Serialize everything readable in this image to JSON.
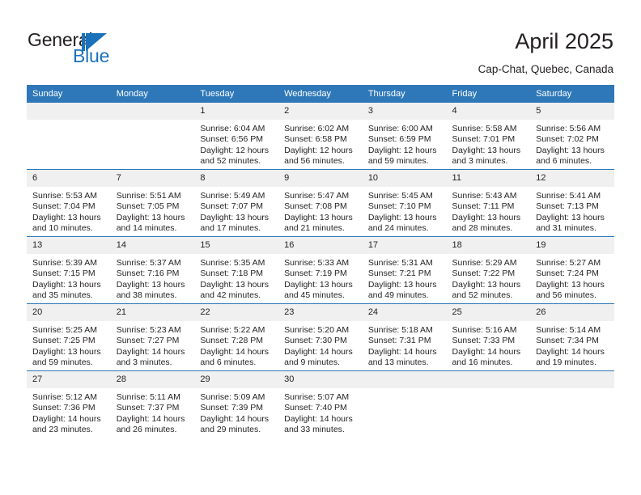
{
  "brand": {
    "name_part1": "General",
    "name_part2": "Blue",
    "logo_icon": "flag-triangle-icon",
    "accent_color": "#1b72bb"
  },
  "header": {
    "title": "April 2025",
    "subtitle": "Cap-Chat, Quebec, Canada"
  },
  "calendar": {
    "header_bg": "#2e77b8",
    "daynum_bg": "#f0f0f0",
    "weekday_headers": [
      "Sunday",
      "Monday",
      "Tuesday",
      "Wednesday",
      "Thursday",
      "Friday",
      "Saturday"
    ],
    "weeks": [
      [
        {
          "day": "",
          "sunrise": "",
          "sunset": "",
          "daylight_line1": "",
          "daylight_line2": ""
        },
        {
          "day": "",
          "sunrise": "",
          "sunset": "",
          "daylight_line1": "",
          "daylight_line2": ""
        },
        {
          "day": "1",
          "sunrise": "Sunrise: 6:04 AM",
          "sunset": "Sunset: 6:56 PM",
          "daylight_line1": "Daylight: 12 hours",
          "daylight_line2": "and 52 minutes."
        },
        {
          "day": "2",
          "sunrise": "Sunrise: 6:02 AM",
          "sunset": "Sunset: 6:58 PM",
          "daylight_line1": "Daylight: 12 hours",
          "daylight_line2": "and 56 minutes."
        },
        {
          "day": "3",
          "sunrise": "Sunrise: 6:00 AM",
          "sunset": "Sunset: 6:59 PM",
          "daylight_line1": "Daylight: 12 hours",
          "daylight_line2": "and 59 minutes."
        },
        {
          "day": "4",
          "sunrise": "Sunrise: 5:58 AM",
          "sunset": "Sunset: 7:01 PM",
          "daylight_line1": "Daylight: 13 hours",
          "daylight_line2": "and 3 minutes."
        },
        {
          "day": "5",
          "sunrise": "Sunrise: 5:56 AM",
          "sunset": "Sunset: 7:02 PM",
          "daylight_line1": "Daylight: 13 hours",
          "daylight_line2": "and 6 minutes."
        }
      ],
      [
        {
          "day": "6",
          "sunrise": "Sunrise: 5:53 AM",
          "sunset": "Sunset: 7:04 PM",
          "daylight_line1": "Daylight: 13 hours",
          "daylight_line2": "and 10 minutes."
        },
        {
          "day": "7",
          "sunrise": "Sunrise: 5:51 AM",
          "sunset": "Sunset: 7:05 PM",
          "daylight_line1": "Daylight: 13 hours",
          "daylight_line2": "and 14 minutes."
        },
        {
          "day": "8",
          "sunrise": "Sunrise: 5:49 AM",
          "sunset": "Sunset: 7:07 PM",
          "daylight_line1": "Daylight: 13 hours",
          "daylight_line2": "and 17 minutes."
        },
        {
          "day": "9",
          "sunrise": "Sunrise: 5:47 AM",
          "sunset": "Sunset: 7:08 PM",
          "daylight_line1": "Daylight: 13 hours",
          "daylight_line2": "and 21 minutes."
        },
        {
          "day": "10",
          "sunrise": "Sunrise: 5:45 AM",
          "sunset": "Sunset: 7:10 PM",
          "daylight_line1": "Daylight: 13 hours",
          "daylight_line2": "and 24 minutes."
        },
        {
          "day": "11",
          "sunrise": "Sunrise: 5:43 AM",
          "sunset": "Sunset: 7:11 PM",
          "daylight_line1": "Daylight: 13 hours",
          "daylight_line2": "and 28 minutes."
        },
        {
          "day": "12",
          "sunrise": "Sunrise: 5:41 AM",
          "sunset": "Sunset: 7:13 PM",
          "daylight_line1": "Daylight: 13 hours",
          "daylight_line2": "and 31 minutes."
        }
      ],
      [
        {
          "day": "13",
          "sunrise": "Sunrise: 5:39 AM",
          "sunset": "Sunset: 7:15 PM",
          "daylight_line1": "Daylight: 13 hours",
          "daylight_line2": "and 35 minutes."
        },
        {
          "day": "14",
          "sunrise": "Sunrise: 5:37 AM",
          "sunset": "Sunset: 7:16 PM",
          "daylight_line1": "Daylight: 13 hours",
          "daylight_line2": "and 38 minutes."
        },
        {
          "day": "15",
          "sunrise": "Sunrise: 5:35 AM",
          "sunset": "Sunset: 7:18 PM",
          "daylight_line1": "Daylight: 13 hours",
          "daylight_line2": "and 42 minutes."
        },
        {
          "day": "16",
          "sunrise": "Sunrise: 5:33 AM",
          "sunset": "Sunset: 7:19 PM",
          "daylight_line1": "Daylight: 13 hours",
          "daylight_line2": "and 45 minutes."
        },
        {
          "day": "17",
          "sunrise": "Sunrise: 5:31 AM",
          "sunset": "Sunset: 7:21 PM",
          "daylight_line1": "Daylight: 13 hours",
          "daylight_line2": "and 49 minutes."
        },
        {
          "day": "18",
          "sunrise": "Sunrise: 5:29 AM",
          "sunset": "Sunset: 7:22 PM",
          "daylight_line1": "Daylight: 13 hours",
          "daylight_line2": "and 52 minutes."
        },
        {
          "day": "19",
          "sunrise": "Sunrise: 5:27 AM",
          "sunset": "Sunset: 7:24 PM",
          "daylight_line1": "Daylight: 13 hours",
          "daylight_line2": "and 56 minutes."
        }
      ],
      [
        {
          "day": "20",
          "sunrise": "Sunrise: 5:25 AM",
          "sunset": "Sunset: 7:25 PM",
          "daylight_line1": "Daylight: 13 hours",
          "daylight_line2": "and 59 minutes."
        },
        {
          "day": "21",
          "sunrise": "Sunrise: 5:23 AM",
          "sunset": "Sunset: 7:27 PM",
          "daylight_line1": "Daylight: 14 hours",
          "daylight_line2": "and 3 minutes."
        },
        {
          "day": "22",
          "sunrise": "Sunrise: 5:22 AM",
          "sunset": "Sunset: 7:28 PM",
          "daylight_line1": "Daylight: 14 hours",
          "daylight_line2": "and 6 minutes."
        },
        {
          "day": "23",
          "sunrise": "Sunrise: 5:20 AM",
          "sunset": "Sunset: 7:30 PM",
          "daylight_line1": "Daylight: 14 hours",
          "daylight_line2": "and 9 minutes."
        },
        {
          "day": "24",
          "sunrise": "Sunrise: 5:18 AM",
          "sunset": "Sunset: 7:31 PM",
          "daylight_line1": "Daylight: 14 hours",
          "daylight_line2": "and 13 minutes."
        },
        {
          "day": "25",
          "sunrise": "Sunrise: 5:16 AM",
          "sunset": "Sunset: 7:33 PM",
          "daylight_line1": "Daylight: 14 hours",
          "daylight_line2": "and 16 minutes."
        },
        {
          "day": "26",
          "sunrise": "Sunrise: 5:14 AM",
          "sunset": "Sunset: 7:34 PM",
          "daylight_line1": "Daylight: 14 hours",
          "daylight_line2": "and 19 minutes."
        }
      ],
      [
        {
          "day": "27",
          "sunrise": "Sunrise: 5:12 AM",
          "sunset": "Sunset: 7:36 PM",
          "daylight_line1": "Daylight: 14 hours",
          "daylight_line2": "and 23 minutes."
        },
        {
          "day": "28",
          "sunrise": "Sunrise: 5:11 AM",
          "sunset": "Sunset: 7:37 PM",
          "daylight_line1": "Daylight: 14 hours",
          "daylight_line2": "and 26 minutes."
        },
        {
          "day": "29",
          "sunrise": "Sunrise: 5:09 AM",
          "sunset": "Sunset: 7:39 PM",
          "daylight_line1": "Daylight: 14 hours",
          "daylight_line2": "and 29 minutes."
        },
        {
          "day": "30",
          "sunrise": "Sunrise: 5:07 AM",
          "sunset": "Sunset: 7:40 PM",
          "daylight_line1": "Daylight: 14 hours",
          "daylight_line2": "and 33 minutes."
        },
        {
          "day": "",
          "sunrise": "",
          "sunset": "",
          "daylight_line1": "",
          "daylight_line2": ""
        },
        {
          "day": "",
          "sunrise": "",
          "sunset": "",
          "daylight_line1": "",
          "daylight_line2": ""
        },
        {
          "day": "",
          "sunrise": "",
          "sunset": "",
          "daylight_line1": "",
          "daylight_line2": ""
        }
      ]
    ]
  }
}
